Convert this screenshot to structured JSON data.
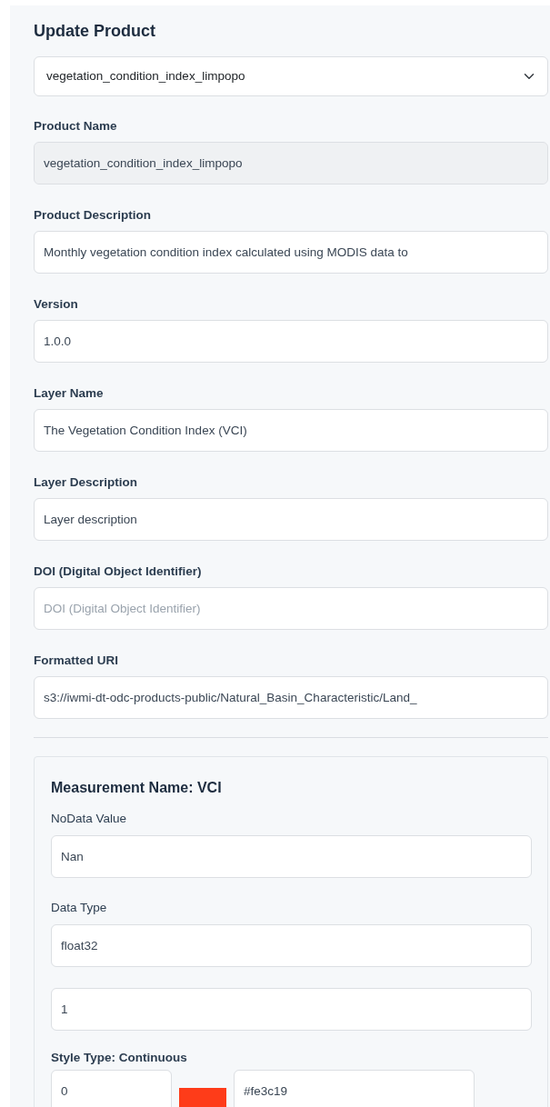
{
  "title": "Update Product",
  "product_select": {
    "value": "vegetation_condition_index_limpopo"
  },
  "fields": [
    {
      "label": "Product Name",
      "value": "vegetation_condition_index_limpopo",
      "disabled": true
    },
    {
      "label": "Product Description",
      "value": "Monthly vegetation condition index calculated using MODIS data to",
      "disabled": false
    },
    {
      "label": "Version",
      "value": "1.0.0",
      "disabled": false
    },
    {
      "label": "Layer Name",
      "value": "The Vegetation Condition Index (VCI)",
      "disabled": false
    },
    {
      "label": "Layer Description",
      "value": "Layer description",
      "disabled": false
    },
    {
      "label": "DOI (Digital Object Identifier)",
      "placeholder": "DOI (Digital Object Identifier)",
      "disabled": false
    },
    {
      "label": "Formatted URI",
      "value": "s3://iwmi-dt-odc-products-public/Natural_Basin_Characteristic/Land_",
      "disabled": false
    }
  ],
  "measurement": {
    "title": "Measurement Name: VCI",
    "fields": [
      {
        "label": "NoData Value",
        "value": "Nan"
      },
      {
        "label": "Data Type",
        "value": "float32"
      },
      {
        "value": "1"
      }
    ],
    "style_type": "Style Type: Continuous",
    "color_stops": [
      {
        "value": "0",
        "color": "#fe3c19",
        "hex": "#fe3c19"
      }
    ]
  }
}
